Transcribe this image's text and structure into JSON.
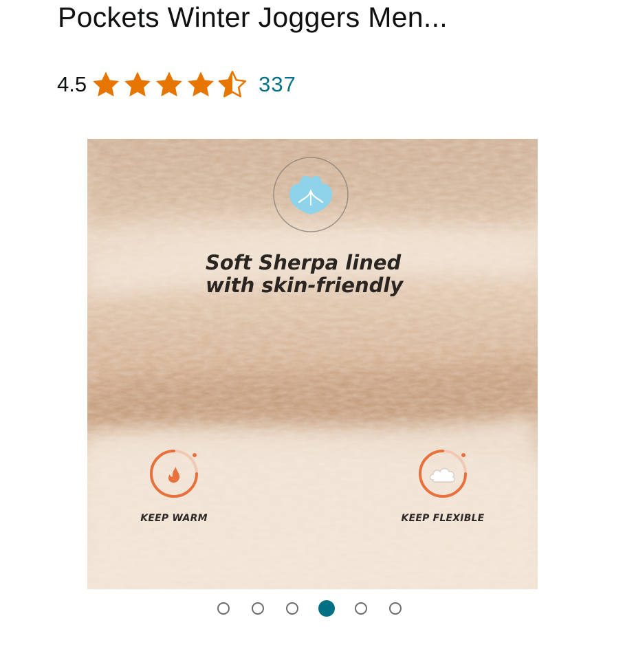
{
  "product": {
    "title": "Pockets Winter Joggers Men...",
    "rating": "4.5",
    "stars_filled": 4.5,
    "stars_max": 5,
    "review_count": "337"
  },
  "gallery": {
    "headline": "Soft Sherpa lined with skin-friendly",
    "features": [
      {
        "label": "KEEP WARM",
        "icon": "flame-icon"
      },
      {
        "label": "KEEP FLEXIBLE",
        "icon": "cloud-icon"
      }
    ],
    "badge_icon": "cotton-icon",
    "current_slide": 4,
    "slide_count": 6
  },
  "colors": {
    "star": "#e77600",
    "link": "#007185",
    "active_dot": "#007185",
    "accent_orange": "#e8703c"
  }
}
